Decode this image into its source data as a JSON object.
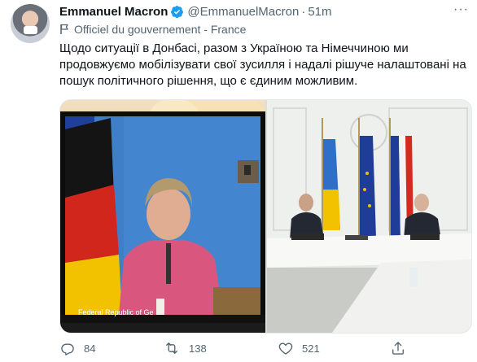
{
  "author": {
    "name": "Emmanuel Macron",
    "handle": "@EmmanuelMacron",
    "separator": "·",
    "time": "51m",
    "affiliation": "Officiel du gouvernement - France"
  },
  "tweet": {
    "text": "Щодо ситуації в Донбасі, разом з Україною та Німеччиною ми продовжуємо мобілізувати свої зусилля і надалі рішуче налаштовані на пошук політичного рішення, що є єдиним можливим."
  },
  "media": {
    "left_caption": "Federal Republic of Ge"
  },
  "actions": {
    "replies": "84",
    "retweets": "138",
    "likes": "521"
  },
  "colors": {
    "secondary_text": "#536471",
    "verified_badge": "#1d9bf0"
  },
  "icons": [
    "verified-badge-icon",
    "flag-icon",
    "more-icon",
    "reply-icon",
    "retweet-icon",
    "like-icon",
    "share-icon"
  ]
}
